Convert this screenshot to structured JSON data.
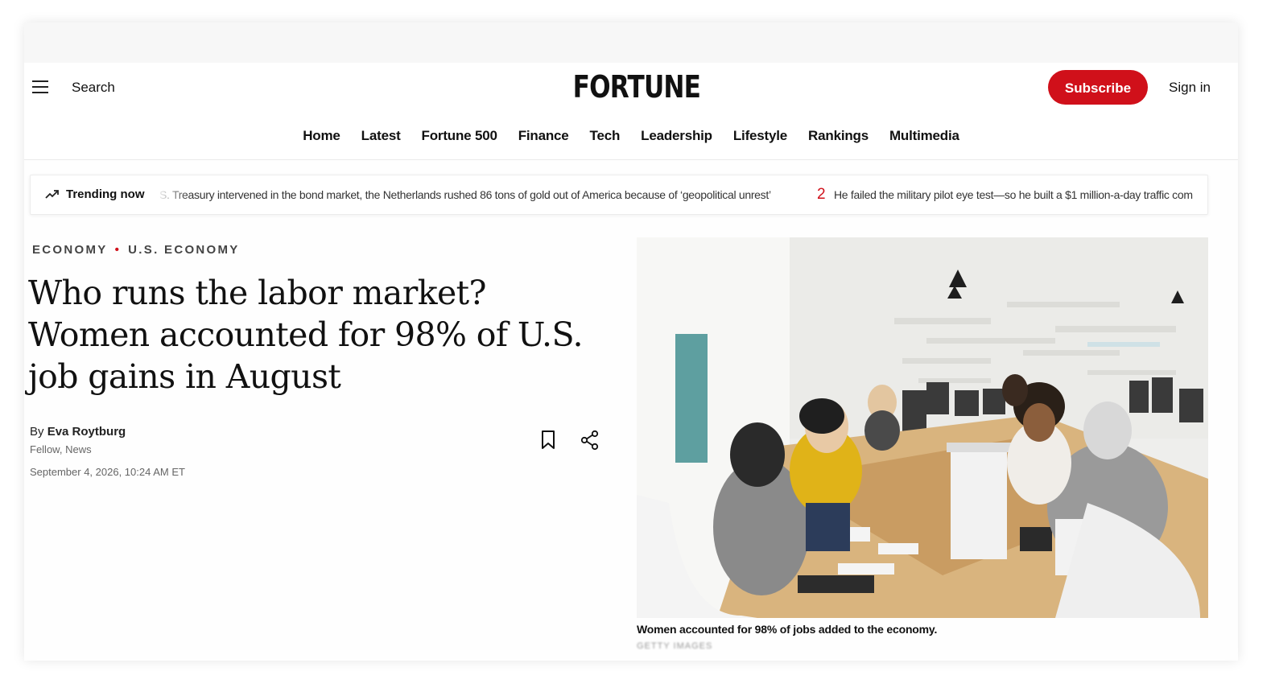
{
  "header": {
    "search_label": "Search",
    "logo_text": "FORTUNE",
    "subscribe_label": "Subscribe",
    "signin_label": "Sign in"
  },
  "nav": {
    "items": [
      "Home",
      "Latest",
      "Fortune 500",
      "Finance",
      "Tech",
      "Leadership",
      "Lifestyle",
      "Rankings",
      "Multimedia"
    ]
  },
  "trending": {
    "label": "Trending now",
    "items": [
      {
        "number": "",
        "text": "S. Treasury intervened in the bond market, the Netherlands rushed 86 tons of gold out of America because of ‘geopolitical unrest’"
      },
      {
        "number": "2",
        "text": "He failed the military pilot eye test—so he built a $1 million-a-day traffic com"
      }
    ]
  },
  "article": {
    "category": "ECONOMY",
    "subcategory": "U.S. ECONOMY",
    "headline": "Who runs the labor market? Women accounted for 98% of U.S. job gains in August",
    "byline_prefix": "By",
    "author": "Eva Roytburg",
    "author_role": "Fellow, News",
    "date": "September 4, 2026, 10:24 AM ET"
  },
  "image": {
    "caption": "Women accounted for 98% of jobs added to the economy.",
    "credit": "GETTY IMAGES"
  },
  "colors": {
    "brand_red": "#d0101a",
    "text": "#111111",
    "muted": "#666666"
  }
}
